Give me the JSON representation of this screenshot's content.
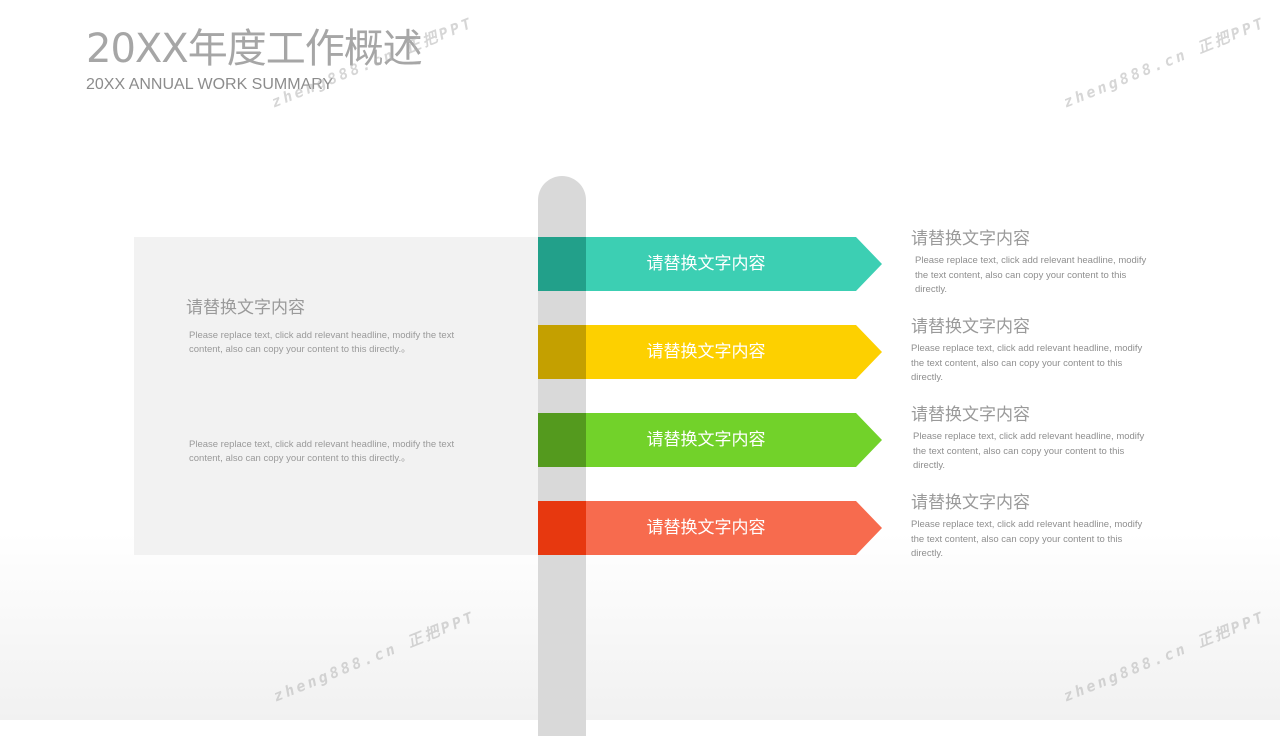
{
  "header": {
    "title": "20XX年度工作概述",
    "subtitle": "20XX ANNUAL WORK SUMMARY"
  },
  "left_panel": {
    "heading": "请替换文字内容",
    "text_1": "Please replace text, click add relevant headline, modify the text content, also can copy your content to this directly.。",
    "text_2": "Please replace text, click add relevant headline, modify the text content, also can copy your content to this directly.。"
  },
  "arrows": [
    {
      "label": "请替换文字内容",
      "color": "#3ccfb3",
      "band_color": "#22a08a"
    },
    {
      "label": "请替换文字内容",
      "color": "#fdd000",
      "band_color": "#c4a000"
    },
    {
      "label": "请替换文字内容",
      "color": "#72d22a",
      "band_color": "#549a1e"
    },
    {
      "label": "请替换文字内容",
      "color": "#f76b4e",
      "band_color": "#e7380f"
    }
  ],
  "items": [
    {
      "heading": "请替换文字内容",
      "text": "Please replace text, click add relevant headline, modify the text content, also can copy your content to this directly."
    },
    {
      "heading": "请替换文字内容",
      "text": "Please replace text, click add relevant headline, modify the text content, also can copy your content to this directly."
    },
    {
      "heading": "请替换文字内容",
      "text": "Please replace text, click add relevant headline, modify the text content, also can copy your content to this directly."
    },
    {
      "heading": "请替换文字内容",
      "text": "Please replace text, click add relevant headline, modify the text content, also can copy your content to this directly."
    }
  ],
  "watermark": "zheng888.cn 正把PPT"
}
